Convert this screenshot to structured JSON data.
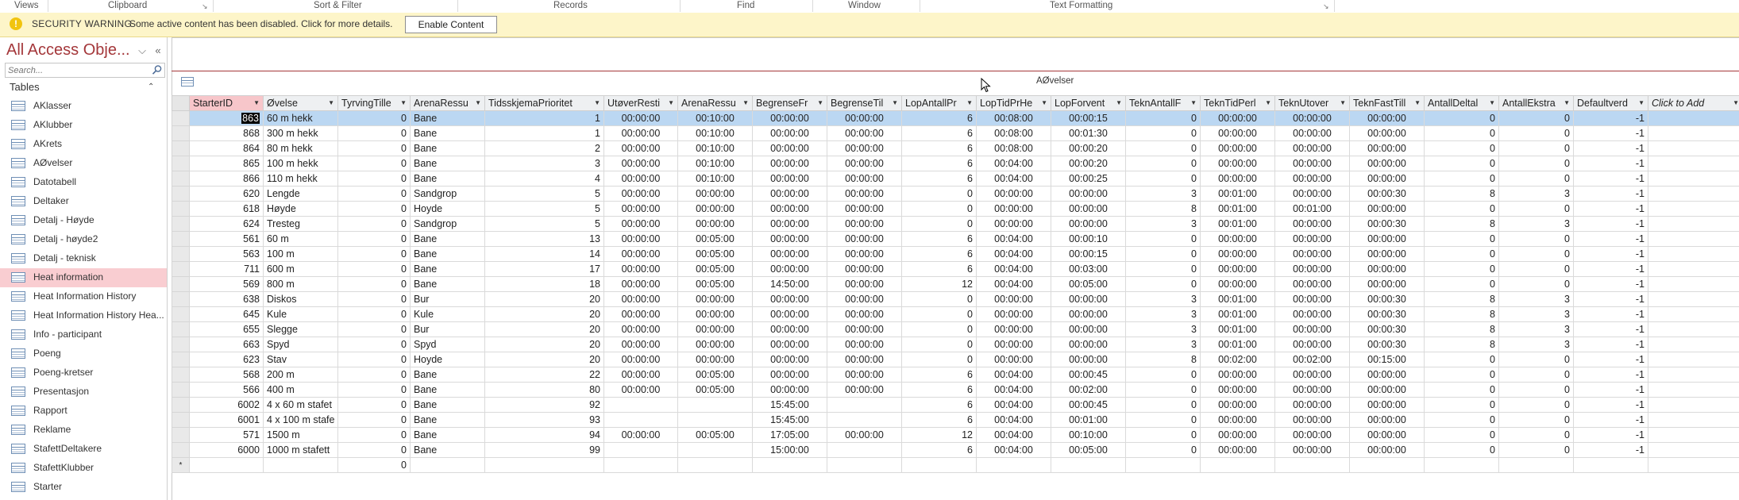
{
  "ribbon": {
    "groups": [
      "Views",
      "Clipboard",
      "Sort & Filter",
      "Records",
      "Find",
      "Window",
      "Text Formatting"
    ]
  },
  "security_bar": {
    "title": "SECURITY WARNING",
    "message": "Some active content has been disabled. Click for more details.",
    "button": "Enable Content",
    "icon": "warning-icon"
  },
  "nav_pane": {
    "title": "All Access Obje...",
    "search_placeholder": "Search...",
    "category": "Tables",
    "items": [
      {
        "label": "AKlasser",
        "selected": false
      },
      {
        "label": "AKlubber",
        "selected": false
      },
      {
        "label": "AKrets",
        "selected": false
      },
      {
        "label": "AØvelser",
        "selected": false
      },
      {
        "label": "Datotabell",
        "selected": false
      },
      {
        "label": "Deltaker",
        "selected": false
      },
      {
        "label": "Detalj - Høyde",
        "selected": false
      },
      {
        "label": "Detalj - høyde2",
        "selected": false
      },
      {
        "label": "Detalj - teknisk",
        "selected": false
      },
      {
        "label": "Heat information",
        "selected": true
      },
      {
        "label": "Heat Information History",
        "selected": false
      },
      {
        "label": "Heat Information History Hea...",
        "selected": false
      },
      {
        "label": "Info - participant",
        "selected": false
      },
      {
        "label": "Poeng",
        "selected": false
      },
      {
        "label": "Poeng-kretser",
        "selected": false
      },
      {
        "label": "Presentasjon",
        "selected": false
      },
      {
        "label": "Rapport",
        "selected": false
      },
      {
        "label": "Reklame",
        "selected": false
      },
      {
        "label": "StafettDeltakere",
        "selected": false
      },
      {
        "label": "StafettKlubber",
        "selected": false
      },
      {
        "label": "Starter",
        "selected": false
      }
    ]
  },
  "document": {
    "tab_title": "AØvelser",
    "columns": [
      "StarterID",
      "Øvelse",
      "TyrvingTille",
      "ArenaRessu",
      "TidsskjemaPrioritet",
      "UtøverResti",
      "ArenaRessu",
      "BegrenseFr",
      "BegrenseTil",
      "LopAntallPr",
      "LopTidPrHe",
      "LopForvent",
      "TeknAntallF",
      "TeknTidPerl",
      "TeknUtover",
      "TeknFastTill",
      "AntallDeltal",
      "AntallEkstra",
      "Defaultverd",
      "Click to Add"
    ],
    "rows": [
      [
        "863",
        "60 m hekk",
        "0",
        "Bane",
        "1",
        "00:00:00",
        "00:10:00",
        "00:00:00",
        "00:00:00",
        "6",
        "00:08:00",
        "00:00:15",
        "0",
        "00:00:00",
        "00:00:00",
        "00:00:00",
        "0",
        "0",
        "-1"
      ],
      [
        "868",
        "300 m hekk",
        "0",
        "Bane",
        "1",
        "00:00:00",
        "00:10:00",
        "00:00:00",
        "00:00:00",
        "6",
        "00:08:00",
        "00:01:30",
        "0",
        "00:00:00",
        "00:00:00",
        "00:00:00",
        "0",
        "0",
        "-1"
      ],
      [
        "864",
        "80 m hekk",
        "0",
        "Bane",
        "2",
        "00:00:00",
        "00:10:00",
        "00:00:00",
        "00:00:00",
        "6",
        "00:08:00",
        "00:00:20",
        "0",
        "00:00:00",
        "00:00:00",
        "00:00:00",
        "0",
        "0",
        "-1"
      ],
      [
        "865",
        "100 m hekk",
        "0",
        "Bane",
        "3",
        "00:00:00",
        "00:10:00",
        "00:00:00",
        "00:00:00",
        "6",
        "00:04:00",
        "00:00:20",
        "0",
        "00:00:00",
        "00:00:00",
        "00:00:00",
        "0",
        "0",
        "-1"
      ],
      [
        "866",
        "110 m hekk",
        "0",
        "Bane",
        "4",
        "00:00:00",
        "00:10:00",
        "00:00:00",
        "00:00:00",
        "6",
        "00:04:00",
        "00:00:25",
        "0",
        "00:00:00",
        "00:00:00",
        "00:00:00",
        "0",
        "0",
        "-1"
      ],
      [
        "620",
        "Lengde",
        "0",
        "Sandgrop",
        "5",
        "00:00:00",
        "00:00:00",
        "00:00:00",
        "00:00:00",
        "0",
        "00:00:00",
        "00:00:00",
        "3",
        "00:01:00",
        "00:00:00",
        "00:00:30",
        "8",
        "3",
        "-1"
      ],
      [
        "618",
        "Høyde",
        "0",
        "Hoyde",
        "5",
        "00:00:00",
        "00:00:00",
        "00:00:00",
        "00:00:00",
        "0",
        "00:00:00",
        "00:00:00",
        "8",
        "00:01:00",
        "00:01:00",
        "00:00:00",
        "0",
        "0",
        "-1"
      ],
      [
        "624",
        "Tresteg",
        "0",
        "Sandgrop",
        "5",
        "00:00:00",
        "00:00:00",
        "00:00:00",
        "00:00:00",
        "0",
        "00:00:00",
        "00:00:00",
        "3",
        "00:01:00",
        "00:00:00",
        "00:00:30",
        "8",
        "3",
        "-1"
      ],
      [
        "561",
        "60 m",
        "0",
        "Bane",
        "13",
        "00:00:00",
        "00:05:00",
        "00:00:00",
        "00:00:00",
        "6",
        "00:04:00",
        "00:00:10",
        "0",
        "00:00:00",
        "00:00:00",
        "00:00:00",
        "0",
        "0",
        "-1"
      ],
      [
        "563",
        "100 m",
        "0",
        "Bane",
        "14",
        "00:00:00",
        "00:05:00",
        "00:00:00",
        "00:00:00",
        "6",
        "00:04:00",
        "00:00:15",
        "0",
        "00:00:00",
        "00:00:00",
        "00:00:00",
        "0",
        "0",
        "-1"
      ],
      [
        "711",
        "600 m",
        "0",
        "Bane",
        "17",
        "00:00:00",
        "00:05:00",
        "00:00:00",
        "00:00:00",
        "6",
        "00:04:00",
        "00:03:00",
        "0",
        "00:00:00",
        "00:00:00",
        "00:00:00",
        "0",
        "0",
        "-1"
      ],
      [
        "569",
        "800 m",
        "0",
        "Bane",
        "18",
        "00:00:00",
        "00:05:00",
        "14:50:00",
        "00:00:00",
        "12",
        "00:04:00",
        "00:05:00",
        "0",
        "00:00:00",
        "00:00:00",
        "00:00:00",
        "0",
        "0",
        "-1"
      ],
      [
        "638",
        "Diskos",
        "0",
        "Bur",
        "20",
        "00:00:00",
        "00:00:00",
        "00:00:00",
        "00:00:00",
        "0",
        "00:00:00",
        "00:00:00",
        "3",
        "00:01:00",
        "00:00:00",
        "00:00:30",
        "8",
        "3",
        "-1"
      ],
      [
        "645",
        "Kule",
        "0",
        "Kule",
        "20",
        "00:00:00",
        "00:00:00",
        "00:00:00",
        "00:00:00",
        "0",
        "00:00:00",
        "00:00:00",
        "3",
        "00:01:00",
        "00:00:00",
        "00:00:30",
        "8",
        "3",
        "-1"
      ],
      [
        "655",
        "Slegge",
        "0",
        "Bur",
        "20",
        "00:00:00",
        "00:00:00",
        "00:00:00",
        "00:00:00",
        "0",
        "00:00:00",
        "00:00:00",
        "3",
        "00:01:00",
        "00:00:00",
        "00:00:30",
        "8",
        "3",
        "-1"
      ],
      [
        "663",
        "Spyd",
        "0",
        "Spyd",
        "20",
        "00:00:00",
        "00:00:00",
        "00:00:00",
        "00:00:00",
        "0",
        "00:00:00",
        "00:00:00",
        "3",
        "00:01:00",
        "00:00:00",
        "00:00:30",
        "8",
        "3",
        "-1"
      ],
      [
        "623",
        "Stav",
        "0",
        "Hoyde",
        "20",
        "00:00:00",
        "00:00:00",
        "00:00:00",
        "00:00:00",
        "0",
        "00:00:00",
        "00:00:00",
        "8",
        "00:02:00",
        "00:02:00",
        "00:15:00",
        "0",
        "0",
        "-1"
      ],
      [
        "568",
        "200 m",
        "0",
        "Bane",
        "22",
        "00:00:00",
        "00:05:00",
        "00:00:00",
        "00:00:00",
        "6",
        "00:04:00",
        "00:00:45",
        "0",
        "00:00:00",
        "00:00:00",
        "00:00:00",
        "0",
        "0",
        "-1"
      ],
      [
        "566",
        "400 m",
        "0",
        "Bane",
        "80",
        "00:00:00",
        "00:05:00",
        "00:00:00",
        "00:00:00",
        "6",
        "00:04:00",
        "00:02:00",
        "0",
        "00:00:00",
        "00:00:00",
        "00:00:00",
        "0",
        "0",
        "-1"
      ],
      [
        "6002",
        "4 x 60 m stafet",
        "0",
        "Bane",
        "92",
        "",
        "",
        "15:45:00",
        "",
        "6",
        "00:04:00",
        "00:00:45",
        "0",
        "00:00:00",
        "00:00:00",
        "00:00:00",
        "0",
        "0",
        "-1"
      ],
      [
        "6001",
        "4 x 100 m stafe",
        "0",
        "Bane",
        "93",
        "",
        "",
        "15:45:00",
        "",
        "6",
        "00:04:00",
        "00:01:00",
        "0",
        "00:00:00",
        "00:00:00",
        "00:00:00",
        "0",
        "0",
        "-1"
      ],
      [
        "571",
        "1500 m",
        "0",
        "Bane",
        "94",
        "00:00:00",
        "00:05:00",
        "17:05:00",
        "00:00:00",
        "12",
        "00:04:00",
        "00:10:00",
        "0",
        "00:00:00",
        "00:00:00",
        "00:00:00",
        "0",
        "0",
        "-1"
      ],
      [
        "6000",
        "1000 m stafett",
        "0",
        "Bane",
        "99",
        "",
        "",
        "15:00:00",
        "",
        "6",
        "00:04:00",
        "00:05:00",
        "0",
        "00:00:00",
        "00:00:00",
        "00:00:00",
        "0",
        "0",
        "-1"
      ]
    ],
    "new_row_marker": "*",
    "new_row_default": "0"
  },
  "colors": {
    "accent": "#a4373a",
    "security_bar": "#fdf5c9",
    "selected_nav": "#f9cdd1",
    "current_row": "#bbd7f2"
  }
}
